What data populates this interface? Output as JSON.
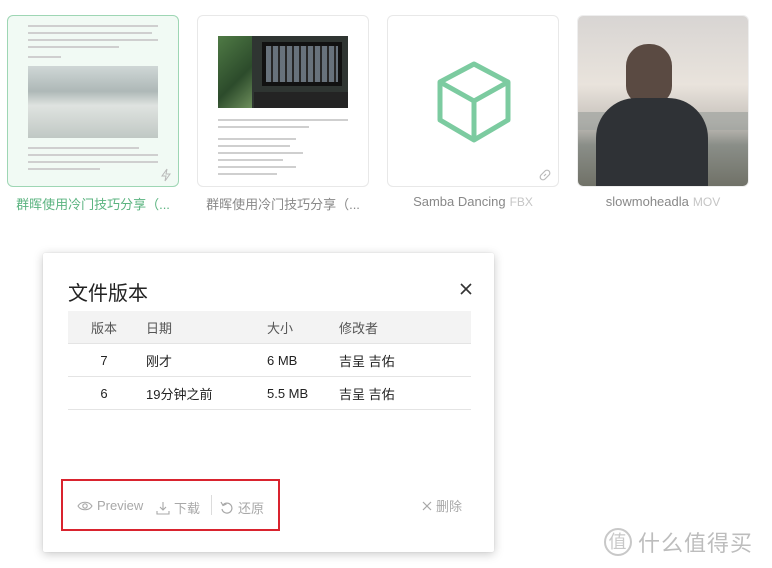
{
  "files": [
    {
      "name": "群晖使用冷门技巧分享（...",
      "ext": ""
    },
    {
      "name": "群晖使用冷门技巧分享（...",
      "ext": ""
    },
    {
      "name": "Samba Dancing",
      "ext": "FBX"
    },
    {
      "name": "slowmoheadla",
      "ext": "MOV"
    }
  ],
  "dialog": {
    "title": "文件版本",
    "columns": {
      "version": "版本",
      "date": "日期",
      "size": "大小",
      "modifier": "修改者"
    },
    "rows": [
      {
        "version": "7",
        "date": "刚才",
        "size": "6 MB",
        "modifier": "吉呈 吉佑"
      },
      {
        "version": "6",
        "date": "19分钟之前",
        "size": "5.5 MB",
        "modifier": "吉呈 吉佑"
      }
    ],
    "actions": {
      "preview": "Preview",
      "download": "下载",
      "restore": "还原",
      "delete": "删除"
    }
  },
  "watermark": {
    "badge": "值",
    "text": "什么值得买"
  },
  "colors": {
    "accent": "#5ab37f",
    "highlight_box": "#d9232e",
    "cube_icon": "#7ccba0"
  }
}
